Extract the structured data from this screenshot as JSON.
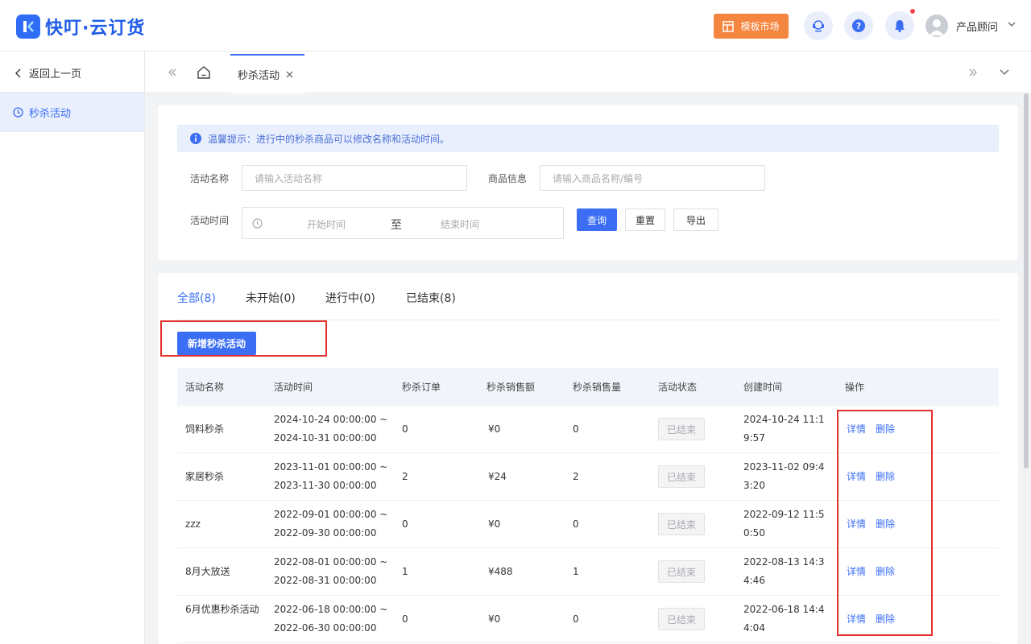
{
  "colors": {
    "primary": "#3b6ef5",
    "orange": "#f5863f",
    "highlight": "#e4312b",
    "notice_bg": "#e9effd"
  },
  "header": {
    "app_name": "快叮·云订货",
    "template_market": "模板市场",
    "user_name": "产品顾问",
    "icons": [
      "service-icon",
      "help-icon",
      "bell-icon",
      "avatar-icon",
      "chevron-down-icon"
    ]
  },
  "sidebar": {
    "back_label": "返回上一页",
    "active_item": "秒杀活动"
  },
  "tabbar": {
    "tab_label": "秒杀活动"
  },
  "filters": {
    "notice": "温馨提示：进行中的秒杀商品可以修改名称和活动时间。",
    "name_label": "活动名称",
    "name_placeholder": "请输入活动名称",
    "goods_label": "商品信息",
    "goods_placeholder": "请输入商品名称/编号",
    "time_label": "活动时间",
    "start_placeholder": "开始时间",
    "range_sep": "至",
    "end_placeholder": "结束时间",
    "query": "查询",
    "reset": "重置",
    "export": "导出"
  },
  "status_tabs": [
    "全部(8)",
    "未开始(0)",
    "进行中(0)",
    "已结束(8)"
  ],
  "add_button": "新增秒杀活动",
  "table": {
    "columns": [
      "活动名称",
      "活动时间",
      "秒杀订单",
      "秒杀销售额",
      "秒杀销售量",
      "活动状态",
      "创建时间",
      "操作"
    ],
    "rows": [
      {
        "name": "饲料秒杀",
        "time": "2024-10-24 00:00:00 ~ 2024-10-31 00:00:00",
        "orders": "0",
        "sales": "¥0",
        "qty": "0",
        "status": "已结束",
        "created": "2024-10-24 11:19:57",
        "detail": "详情",
        "delete": "删除"
      },
      {
        "name": "家居秒杀",
        "time": "2023-11-01 00:00:00 ~ 2023-11-30 00:00:00",
        "orders": "2",
        "sales": "¥24",
        "qty": "2",
        "status": "已结束",
        "created": "2023-11-02 09:43:20",
        "detail": "详情",
        "delete": "删除"
      },
      {
        "name": "zzz",
        "time": "2022-09-01 00:00:00 ~ 2022-09-30 00:00:00",
        "orders": "0",
        "sales": "¥0",
        "qty": "0",
        "status": "已结束",
        "created": "2022-09-12 11:50:50",
        "detail": "详情",
        "delete": "删除"
      },
      {
        "name": "8月大放送",
        "time": "2022-08-01 00:00:00 ~ 2022-08-31 00:00:00",
        "orders": "1",
        "sales": "¥488",
        "qty": "1",
        "status": "已结束",
        "created": "2022-08-13 14:34:46",
        "detail": "详情",
        "delete": "删除"
      },
      {
        "name": "6月优惠秒杀活动",
        "time": "2022-06-18 00:00:00 ~ 2022-06-30 00:00:00",
        "orders": "0",
        "sales": "¥0",
        "qty": "0",
        "status": "已结束",
        "created": "2022-06-18 14:44:04",
        "detail": "详情",
        "delete": "删除"
      }
    ]
  }
}
